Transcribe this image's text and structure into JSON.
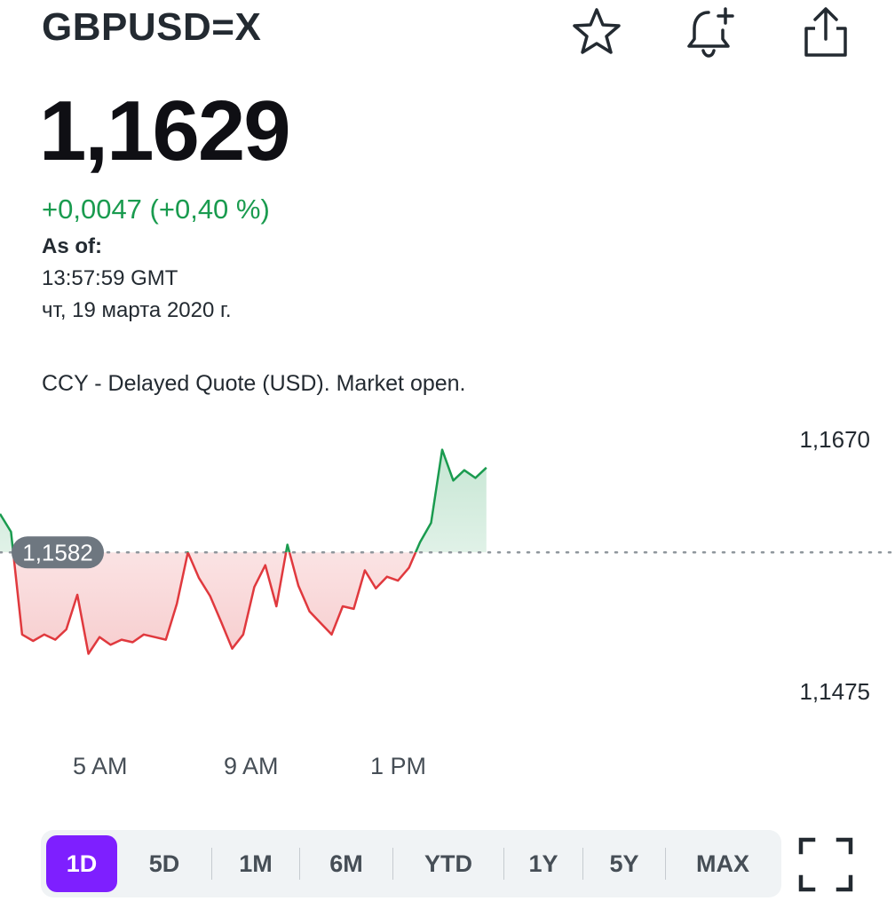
{
  "header": {
    "ticker": "GBPUSD=X",
    "icons": [
      "star-icon",
      "bell-plus-icon",
      "share-icon"
    ]
  },
  "quote": {
    "price": "1,1629",
    "change": "+0,0047 (+0,40 %)",
    "asof_label": "As of:",
    "asof_time": "13:57:59 GMT",
    "asof_date": "чт, 19 марта 2020 г.",
    "note": "CCY - Delayed Quote (USD). Market open."
  },
  "colors": {
    "up": "#1a9b4f",
    "down": "#e0393e",
    "accent": "#7e1fff"
  },
  "chart_data": {
    "type": "line",
    "previous_close": 1.1582,
    "previous_close_label": "1,1582",
    "y_labels": {
      "high": "1,1670",
      "low": "1,1475"
    },
    "ylim": [
      1.1475,
      1.167
    ],
    "x_ticks": [
      "5 AM",
      "9 AM",
      "1 PM"
    ],
    "x_tick_hours": [
      5,
      9,
      13
    ],
    "x": [
      2.0,
      2.3,
      2.6,
      2.9,
      3.2,
      3.5,
      3.8,
      4.1,
      4.4,
      4.7,
      5.0,
      5.3,
      5.6,
      5.9,
      6.2,
      6.5,
      6.8,
      7.1,
      7.4,
      7.7,
      8.0,
      8.3,
      8.6,
      8.9,
      9.2,
      9.5,
      9.8,
      10.1,
      10.4,
      10.7,
      11.0,
      11.3,
      11.6,
      11.9,
      12.2,
      12.5,
      12.8,
      13.1,
      13.4,
      13.7,
      14.0,
      14.3,
      14.6,
      14.9,
      15.2
    ],
    "y": [
      1.1612,
      1.1598,
      1.1518,
      1.1513,
      1.1518,
      1.1514,
      1.1522,
      1.1549,
      1.1503,
      1.1516,
      1.151,
      1.1514,
      1.1512,
      1.1518,
      1.1516,
      1.1514,
      1.1542,
      1.1582,
      1.1562,
      1.1548,
      1.1528,
      1.1507,
      1.1518,
      1.1555,
      1.1572,
      1.154,
      1.1588,
      1.1556,
      1.1536,
      1.1527,
      1.1518,
      1.154,
      1.1538,
      1.1568,
      1.1554,
      1.1563,
      1.156,
      1.157,
      1.159,
      1.1605,
      1.1662,
      1.1638,
      1.1646,
      1.164,
      1.1648
    ]
  },
  "ranges": {
    "items": [
      "1D",
      "5D",
      "1M",
      "6M",
      "YTD",
      "1Y",
      "5Y",
      "MAX"
    ],
    "selected": "1D"
  }
}
